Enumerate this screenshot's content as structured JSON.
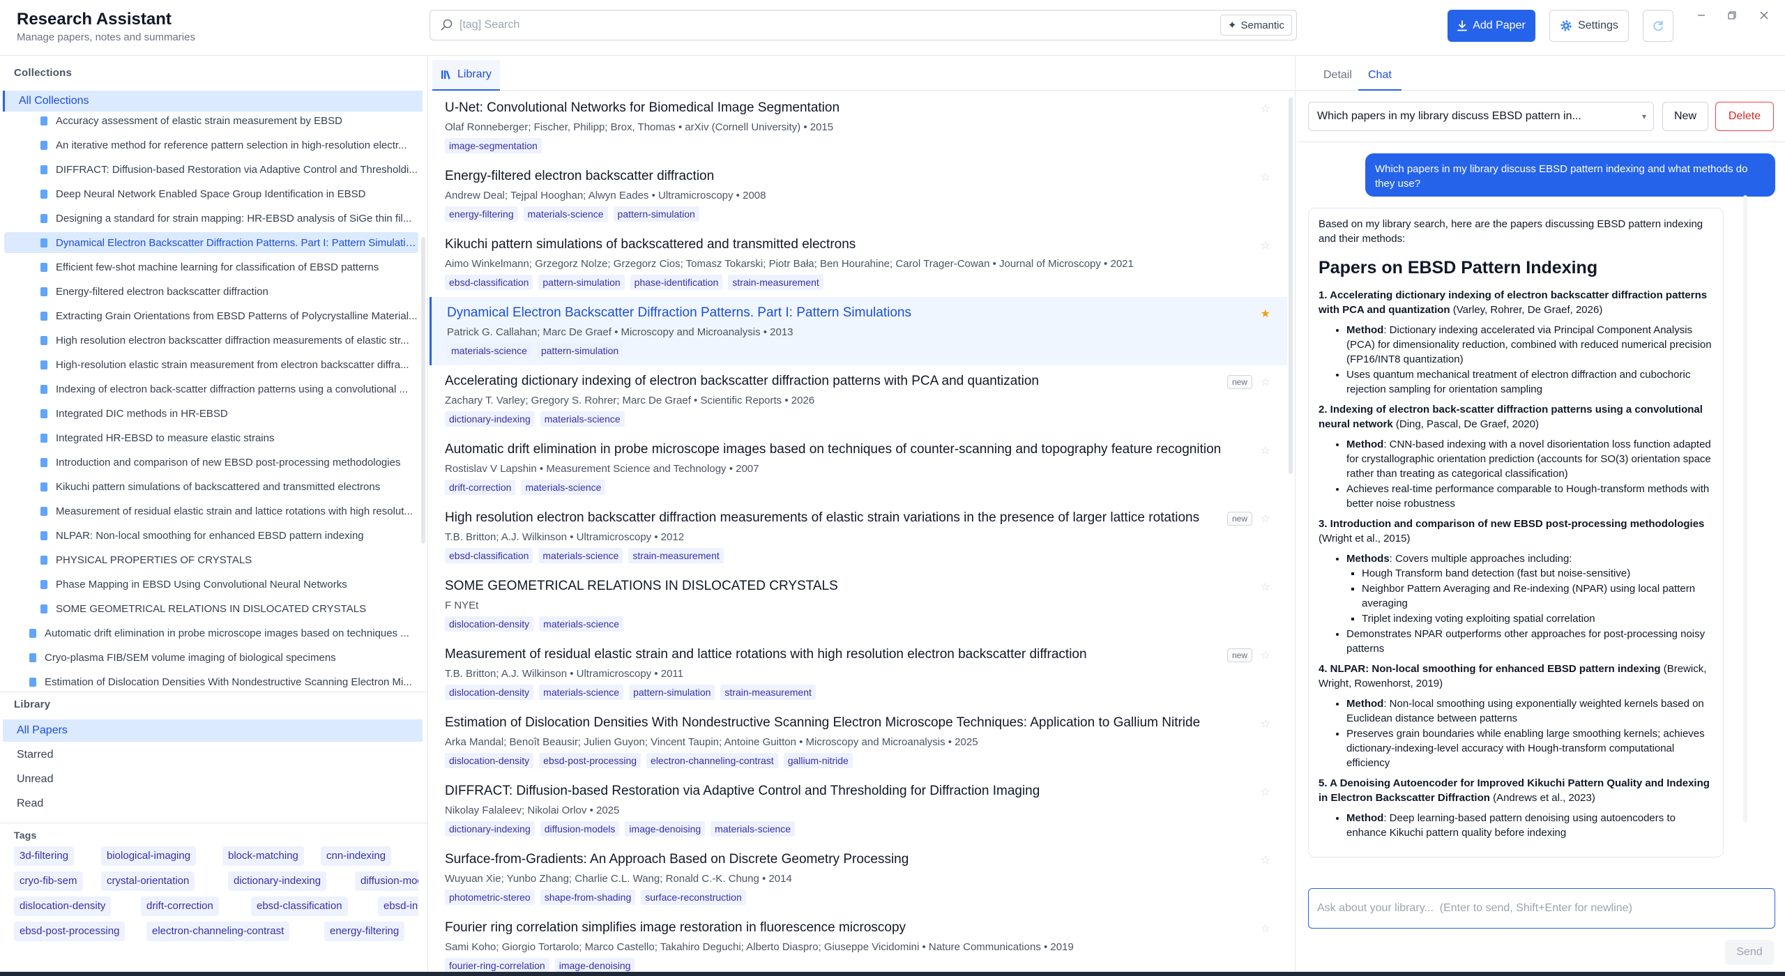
{
  "app": {
    "title": "Research Assistant",
    "subtitle": "Manage papers, notes and summaries"
  },
  "search": {
    "placeholder": "[tag] Search",
    "semantic_label": "Semantic"
  },
  "toolbar": {
    "add_paper_label": "Add Paper",
    "settings_label": "Settings"
  },
  "colors": {
    "accent": "#2563eb",
    "accent_light": "#dbeafe",
    "tag_bg": "#eef2ff",
    "tag_text": "#3730a3",
    "star_active": "#f59e0b",
    "danger": "#dc2626"
  },
  "sidebar": {
    "collections_heading": "Collections",
    "all_collections_label": "All Collections",
    "collections": [
      {
        "label": "Accuracy assessment of elastic strain measurement by EBSD",
        "level": 2,
        "active": false
      },
      {
        "label": "An iterative method for reference pattern selection in high-resolution electr...",
        "level": 2,
        "active": false
      },
      {
        "label": "DIFFRACT: Diffusion-based Restoration via Adaptive Control and Thresholdi...",
        "level": 2,
        "active": false
      },
      {
        "label": "Deep Neural Network Enabled Space Group Identification in EBSD",
        "level": 2,
        "active": false
      },
      {
        "label": "Designing a standard for strain mapping: HR-EBSD analysis of SiGe thin fil...",
        "level": 2,
        "active": false
      },
      {
        "label": "Dynamical Electron Backscatter Diffraction Patterns. Part I: Pattern Simulatio...",
        "level": 2,
        "active": true
      },
      {
        "label": "Efficient few-shot machine learning for classification of EBSD patterns",
        "level": 2,
        "active": false
      },
      {
        "label": "Energy-filtered electron backscatter diffraction",
        "level": 2,
        "active": false
      },
      {
        "label": "Extracting Grain Orientations from EBSD Patterns of Polycrystalline Material...",
        "level": 2,
        "active": false
      },
      {
        "label": "High resolution electron backscatter diffraction measurements of elastic str...",
        "level": 2,
        "active": false
      },
      {
        "label": "High-resolution elastic strain measurement from electron backscatter diffra...",
        "level": 2,
        "active": false
      },
      {
        "label": "Indexing of electron back-scatter diffraction patterns using a convolutional ...",
        "level": 2,
        "active": false
      },
      {
        "label": "Integrated DIC methods in HR-EBSD",
        "level": 2,
        "active": false
      },
      {
        "label": "Integrated HR-EBSD to measure elastic strains",
        "level": 2,
        "active": false
      },
      {
        "label": "Introduction and comparison of new EBSD post-processing methodologies",
        "level": 2,
        "active": false
      },
      {
        "label": "Kikuchi pattern simulations of backscattered and transmitted electrons",
        "level": 2,
        "active": false
      },
      {
        "label": "Measurement of residual elastic strain and lattice rotations with high resolut...",
        "level": 2,
        "active": false
      },
      {
        "label": "NLPAR: Non-local smoothing for enhanced EBSD pattern indexing",
        "level": 2,
        "active": false
      },
      {
        "label": "PHYSICAL PROPERTIES OF CRYSTALS",
        "level": 2,
        "active": false
      },
      {
        "label": "Phase Mapping in EBSD Using Convolutional Neural Networks",
        "level": 2,
        "active": false
      },
      {
        "label": "SOME GEOMETRICAL RELATIONS IN DISLOCATED CRYSTALS",
        "level": 2,
        "active": false
      },
      {
        "label": "Automatic drift elimination in probe microscope images based on techniques ...",
        "level": 1,
        "active": false
      },
      {
        "label": "Cryo-plasma FIB/SEM volume imaging of biological specimens",
        "level": 1,
        "active": false
      },
      {
        "label": "Estimation of Dislocation Densities With Nondestructive Scanning Electron Mi...",
        "level": 1,
        "active": false
      }
    ],
    "library_heading": "Library",
    "library_items": [
      {
        "label": "All Papers",
        "active": true
      },
      {
        "label": "Starred",
        "active": false
      },
      {
        "label": "Unread",
        "active": false
      },
      {
        "label": "Read",
        "active": false
      }
    ],
    "tags_heading": "Tags",
    "tags": [
      [
        "3d-filtering",
        "biological-imaging",
        "block-matching",
        "cnn-indexing"
      ],
      [
        "cryo-fib-sem",
        "crystal-orientation",
        "dictionary-indexing",
        "diffusion-models"
      ],
      [
        "dislocation-density",
        "drift-correction",
        "ebsd-classification",
        "ebsd-indexing"
      ],
      [
        "ebsd-post-processing",
        "electron-channeling-contrast",
        "energy-filtering"
      ]
    ]
  },
  "middle": {
    "tab_label": "Library",
    "papers": [
      {
        "title": "U-Net: Convolutional Networks for Biomedical Image Segmentation",
        "meta": "Olaf Ronneberger; Fischer, Philipp; Brox, Thomas • arXiv (Cornell University) • 2015",
        "tags": [
          "image-segmentation"
        ],
        "starred": false,
        "new": false,
        "selected": false
      },
      {
        "title": "Energy-filtered electron backscatter diffraction",
        "meta": "Andrew Deal; Tejpal Hooghan; Alwyn Eades • Ultramicroscopy • 2008",
        "tags": [
          "energy-filtering",
          "materials-science",
          "pattern-simulation"
        ],
        "starred": false,
        "new": false,
        "selected": false
      },
      {
        "title": "Kikuchi pattern simulations of backscattered and transmitted electrons",
        "meta": "Aimo Winkelmann; Grzegorz Nolze; Grzegorz Cios; Tomasz Tokarski; Piotr Bała; Ben Hourahine; Carol Trager-Cowan • Journal of Microscopy • 2021",
        "tags": [
          "ebsd-classification",
          "pattern-simulation",
          "phase-identification",
          "strain-measurement"
        ],
        "starred": false,
        "new": false,
        "selected": false
      },
      {
        "title": "Dynamical Electron Backscatter Diffraction Patterns. Part I: Pattern Simulations",
        "meta": "Patrick G. Callahan; Marc De Graef • Microscopy and Microanalysis • 2013",
        "tags": [
          "materials-science",
          "pattern-simulation"
        ],
        "starred": true,
        "new": false,
        "selected": true
      },
      {
        "title": "Accelerating dictionary indexing of electron backscatter diffraction patterns with PCA and quantization",
        "meta": "Zachary T. Varley; Gregory S. Rohrer; Marc De Graef • Scientific Reports • 2026",
        "tags": [
          "dictionary-indexing",
          "materials-science"
        ],
        "starred": false,
        "new": true,
        "selected": false
      },
      {
        "title": "Automatic drift elimination in probe microscope images based on techniques of counter-scanning and topography feature recognition",
        "meta": "Rostislav V Lapshin • Measurement Science and Technology • 2007",
        "tags": [
          "drift-correction",
          "materials-science"
        ],
        "starred": false,
        "new": false,
        "selected": false
      },
      {
        "title": "High resolution electron backscatter diffraction measurements of elastic strain variations in the presence of larger lattice rotations",
        "meta": "T.B. Britton; A.J. Wilkinson • Ultramicroscopy • 2012",
        "tags": [
          "ebsd-classification",
          "materials-science",
          "strain-measurement"
        ],
        "starred": false,
        "new": true,
        "selected": false
      },
      {
        "title": "SOME GEOMETRICAL RELATIONS IN DISLOCATED CRYSTALS",
        "meta": "F NYEt",
        "tags": [
          "dislocation-density",
          "materials-science"
        ],
        "starred": false,
        "new": false,
        "selected": false
      },
      {
        "title": "Measurement of residual elastic strain and lattice rotations with high resolution electron backscatter diffraction",
        "meta": "T.B. Britton; A.J. Wilkinson • Ultramicroscopy • 2011",
        "tags": [
          "dislocation-density",
          "materials-science",
          "pattern-simulation",
          "strain-measurement"
        ],
        "starred": false,
        "new": true,
        "selected": false
      },
      {
        "title": "Estimation of Dislocation Densities With Nondestructive Scanning Electron Microscope Techniques: Application to Gallium Nitride",
        "meta": "Arka Mandal; Benoît Beausir; Julien Guyon; Vincent Taupin; Antoine Guitton • Microscopy and Microanalysis • 2025",
        "tags": [
          "dislocation-density",
          "ebsd-post-processing",
          "electron-channeling-contrast",
          "gallium-nitride"
        ],
        "starred": false,
        "new": false,
        "selected": false
      },
      {
        "title": "DIFFRACT: Diffusion-based Restoration via Adaptive Control and Thresholding for Diffraction Imaging",
        "meta": "Nikolay Falaleev; Nikolai Orlov • 2025",
        "tags": [
          "dictionary-indexing",
          "diffusion-models",
          "image-denoising",
          "materials-science"
        ],
        "starred": false,
        "new": false,
        "selected": false
      },
      {
        "title": "Surface-from-Gradients: An Approach Based on Discrete Geometry Processing",
        "meta": "Wuyuan Xie; Yunbo Zhang; Charlie C.L. Wang; Ronald C.-K. Chung • 2014",
        "tags": [
          "photometric-stereo",
          "shape-from-shading",
          "surface-reconstruction"
        ],
        "starred": false,
        "new": false,
        "selected": false
      },
      {
        "title": "Fourier ring correlation simplifies image restoration in fluorescence microscopy",
        "meta": "Sami Koho; Giorgio Tortarolo; Marco Castello; Takahiro Deguchi; Alberto Diaspro; Giuseppe Vicidomini • Nature Communications • 2019",
        "tags": [
          "fourier-ring-correlation",
          "image-denoising"
        ],
        "starred": false,
        "new": false,
        "selected": false
      }
    ],
    "new_badge_label": "new"
  },
  "right": {
    "tabs": [
      {
        "label": "Detail",
        "active": false
      },
      {
        "label": "Chat",
        "active": true
      }
    ],
    "chat_select_value": "Which papers in my library discuss EBSD pattern in...",
    "new_label": "New",
    "delete_label": "Delete",
    "user_message": "Which papers in my library discuss EBSD pattern indexing and what methods do they use?",
    "assistant": {
      "intro": "Based on my library search, here are the papers discussing EBSD pattern indexing and their methods:",
      "heading": "Papers on EBSD Pattern Indexing",
      "items": [
        {
          "title": "1. Accelerating dictionary indexing of electron backscatter diffraction patterns with PCA and quantization",
          "cite": " (Varley, Rohrer, De Graef, 2026)",
          "bullets": [
            {
              "label": "Method",
              "text": ": Dictionary indexing accelerated via Principal Component Analysis (PCA) for dimensionality reduction, combined with reduced numerical precision (FP16/INT8 quantization)",
              "sub": []
            },
            {
              "label": "",
              "text": "Uses quantum mechanical treatment of electron diffraction and cubochoric rejection sampling for orientation sampling",
              "sub": []
            }
          ]
        },
        {
          "title": "2. Indexing of electron back-scatter diffraction patterns using a convolutional neural network",
          "cite": " (Ding, Pascal, De Graef, 2020)",
          "bullets": [
            {
              "label": "Method",
              "text": ": CNN-based indexing with a novel disorientation loss function adapted for crystallographic orientation prediction (accounts for SO(3) orientation space rather than treating as categorical classification)",
              "sub": []
            },
            {
              "label": "",
              "text": "Achieves real-time performance comparable to Hough-transform methods with better noise robustness",
              "sub": []
            }
          ]
        },
        {
          "title": "3. Introduction and comparison of new EBSD post-processing methodologies",
          "cite": " (Wright et al., 2015)",
          "bullets": [
            {
              "label": "Methods",
              "text": ": Covers multiple approaches including:",
              "sub": [
                "Hough Transform band detection (fast but noise-sensitive)",
                "Neighbor Pattern Averaging and Re-indexing (NPAR) using local pattern averaging",
                "Triplet indexing voting exploiting spatial correlation"
              ]
            },
            {
              "label": "",
              "text": "Demonstrates NPAR outperforms other approaches for post-processing noisy patterns",
              "sub": []
            }
          ]
        },
        {
          "title": "4. NLPAR: Non-local smoothing for enhanced EBSD pattern indexing",
          "cite": " (Brewick, Wright, Rowenhorst, 2019)",
          "bullets": [
            {
              "label": "Method",
              "text": ": Non-local smoothing using exponentially weighted kernels based on Euclidean distance between patterns",
              "sub": []
            },
            {
              "label": "",
              "text": "Preserves grain boundaries while enabling large smoothing kernels; achieves dictionary-indexing-level accuracy with Hough-transform computational efficiency",
              "sub": []
            }
          ]
        },
        {
          "title": "5. A Denoising Autoencoder for Improved Kikuchi Pattern Quality and Indexing in Electron Backscatter Diffraction",
          "cite": " (Andrews et al., 2023)",
          "bullets": [
            {
              "label": "Method",
              "text": ": Deep learning-based pattern denoising using autoencoders to enhance Kikuchi pattern quality before indexing",
              "sub": []
            }
          ]
        }
      ]
    },
    "chat_input_placeholder": "Ask about your library...  (Enter to send, Shift+Enter for newline)",
    "send_label": "Send"
  }
}
